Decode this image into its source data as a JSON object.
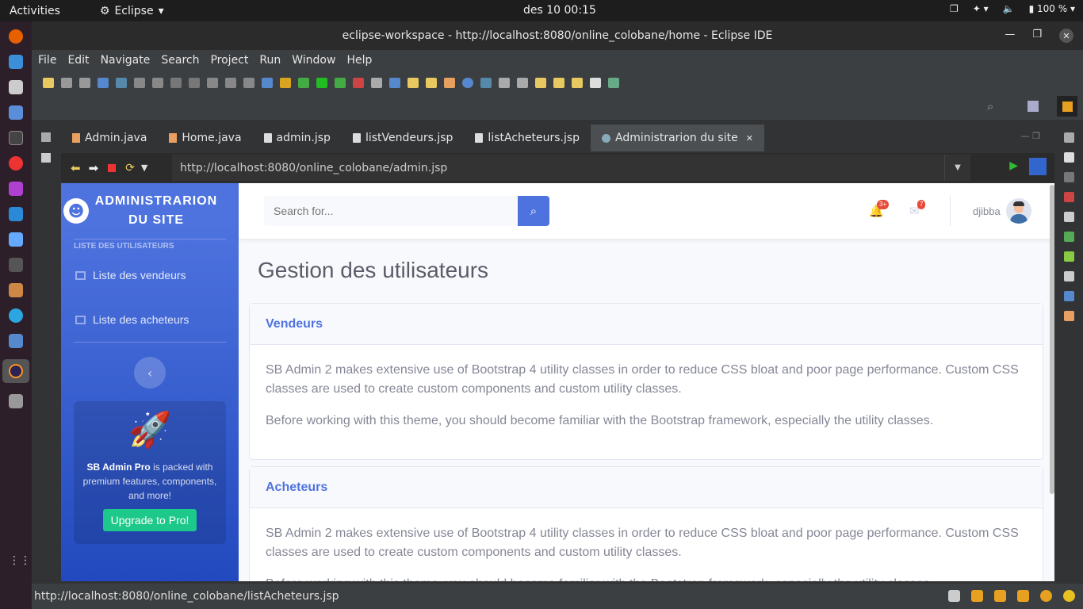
{
  "system": {
    "activities": "Activities",
    "app_menu": "Eclipse",
    "clock": "des 10  00:15",
    "battery": "100 %"
  },
  "window": {
    "title": "eclipse-workspace - http://localhost:8080/online_colobane/home - Eclipse IDE"
  },
  "menu": [
    "File",
    "Edit",
    "Navigate",
    "Search",
    "Project",
    "Run",
    "Window",
    "Help"
  ],
  "tabs": [
    {
      "label": "Admin.java",
      "icon": "java-file-icon"
    },
    {
      "label": "Home.java",
      "icon": "java-file-icon"
    },
    {
      "label": "admin.jsp",
      "icon": "jsp-file-icon"
    },
    {
      "label": "listVendeurs.jsp",
      "icon": "jsp-file-icon"
    },
    {
      "label": "listAcheteurs.jsp",
      "icon": "jsp-file-icon"
    },
    {
      "label": "Administrarion du site",
      "icon": "globe-icon",
      "active": true
    }
  ],
  "browser": {
    "url": "http://localhost:8080/online_colobane/admin.jsp"
  },
  "page": {
    "brand": "ADMINISTRARION DU SITE",
    "sidebar_heading": "LISTE DES UTILISATEURS",
    "sidebar_items": [
      "Liste des vendeurs",
      "Liste des acheteurs"
    ],
    "promo": {
      "bold": "SB Admin Pro",
      "text": " is packed with premium features, components, and more!",
      "button": "Upgrade to Pro!"
    },
    "search_placeholder": "Search for...",
    "alerts_badge": "3+",
    "messages_badge": "7",
    "username": "djibba",
    "title": "Gestion des utilisateurs",
    "cards": [
      {
        "header": "Vendeurs",
        "p1": "SB Admin 2 makes extensive use of Bootstrap 4 utility classes in order to reduce CSS bloat and poor page performance. Custom CSS classes are used to create custom components and custom utility classes.",
        "p2": "Before working with this theme, you should become familiar with the Bootstrap framework, especially the utility classes."
      },
      {
        "header": "Acheteurs",
        "p1": "SB Admin 2 makes extensive use of Bootstrap 4 utility classes in order to reduce CSS bloat and poor page performance. Custom CSS classes are used to create custom components and custom utility classes.",
        "p2": "Before working with this theme, you should become familiar with the Bootstrap framework, especially the utility classes."
      }
    ]
  },
  "status": {
    "text": "http://localhost:8080/online_colobane/listAcheteurs.jsp"
  },
  "colors": {
    "primary": "#4e73df",
    "success": "#1cc88a",
    "danger": "#e74a3b",
    "eclipse_bg": "#3c3f41"
  }
}
